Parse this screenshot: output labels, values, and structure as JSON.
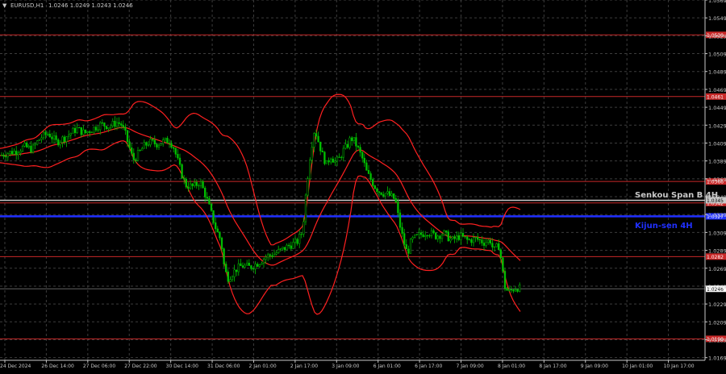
{
  "window": {
    "symbol_title": "EURUSD,H1",
    "ohlc": "1.0246 1.0249 1.0243 1.0246"
  },
  "colors": {
    "background": "#000000",
    "grid": "#3c3c3c",
    "candle_up": "#00c000",
    "candle_down": "#00c000",
    "ichimoku_tenkan": "#ff2020",
    "ichimoku_kijun": "#ff2020",
    "bollinger": "#ff2020",
    "level_line": "#c82828",
    "senkou_line": "#c8c8c8",
    "kijun_4h_line": "#2030ff",
    "axis_text": "#c8c8c8",
    "current_price_label_bg": "#ffffff"
  },
  "annotations": {
    "senkou_label": "Senkou Span B 4H",
    "kijun_label": "Kijun-sen 4H"
  },
  "chart_data": {
    "type": "candlestick",
    "ylim": [
      1.0166,
      1.0569
    ],
    "y_ticks": [
      "1.0569",
      "1.0549",
      "1.0529",
      "1.0509",
      "1.0489",
      "1.0469",
      "1.0449",
      "1.0429",
      "1.0409",
      "1.0389",
      "1.0369",
      "1.0349",
      "1.0329",
      "1.0309",
      "1.0289",
      "1.0269",
      "1.0249",
      "1.0229",
      "1.0209",
      "1.0189",
      "1.0169"
    ],
    "y_tick_values": [
      1.0569,
      1.0549,
      1.0529,
      1.0509,
      1.0489,
      1.0469,
      1.0449,
      1.0429,
      1.0409,
      1.0389,
      1.0369,
      1.0349,
      1.0329,
      1.0309,
      1.0289,
      1.0269,
      1.0249,
      1.0229,
      1.0209,
      1.0189,
      1.0169
    ],
    "x_tick_labels": [
      "24 Dec 2024",
      "26 Dec 14:00",
      "27 Dec 06:00",
      "27 Dec 22:00",
      "30 Dec 14:00",
      "31 Dec 06:00",
      "2 Jan 01:00",
      "2 Jan 17:00",
      "3 Jan 09:00",
      "6 Jan 01:00",
      "6 Jan 17:00",
      "7 Jan 09:00",
      "8 Jan 01:00",
      "8 Jan 17:00",
      "9 Jan 09:00",
      "10 Jan 01:00",
      "10 Jan 17:00"
    ],
    "horizontal_levels": [
      {
        "value": 1.053,
        "label": "1.0530",
        "kind": "level"
      },
      {
        "value": 1.0461,
        "label": "1.0461",
        "kind": "level"
      },
      {
        "value": 1.0366,
        "label": "1.0366",
        "kind": "level"
      },
      {
        "value": 1.0342,
        "label": "1.0342",
        "kind": "level"
      },
      {
        "value": 1.0282,
        "label": "1.0282",
        "kind": "level"
      },
      {
        "value": 1.019,
        "label": "1.0190",
        "kind": "level"
      },
      {
        "value": 1.0345,
        "label": "1.0345",
        "kind": "senkou"
      },
      {
        "value": 1.0327,
        "label": "1.0327",
        "kind": "kijun"
      }
    ],
    "current_price": {
      "value": 1.0246,
      "label": "1.0246"
    },
    "close_path": [
      [
        0,
        1.0395
      ],
      [
        10,
        1.0398
      ],
      [
        20,
        1.04
      ],
      [
        30,
        1.0405
      ],
      [
        40,
        1.0402
      ],
      [
        50,
        1.0415
      ],
      [
        60,
        1.042
      ],
      [
        70,
        1.041
      ],
      [
        80,
        1.0415
      ],
      [
        95,
        1.0425
      ],
      [
        105,
        1.042
      ],
      [
        115,
        1.0425
      ],
      [
        125,
        1.043
      ],
      [
        135,
        1.0428
      ],
      [
        145,
        1.0432
      ],
      [
        150,
        1.043
      ],
      [
        155,
        1.042
      ],
      [
        160,
        1.0405
      ],
      [
        165,
        1.039
      ],
      [
        170,
        1.0395
      ],
      [
        178,
        1.0405
      ],
      [
        185,
        1.041
      ],
      [
        195,
        1.0408
      ],
      [
        200,
        1.041
      ],
      [
        210,
        1.0412
      ],
      [
        215,
        1.0405
      ],
      [
        220,
        1.039
      ],
      [
        225,
        1.0375
      ],
      [
        230,
        1.0362
      ],
      [
        240,
        1.036
      ],
      [
        248,
        1.0366
      ],
      [
        255,
        1.035
      ],
      [
        262,
        1.033
      ],
      [
        268,
        1.0312
      ],
      [
        274,
        1.03
      ],
      [
        278,
        1.027
      ],
      [
        282,
        1.0258
      ],
      [
        287,
        1.0262
      ],
      [
        293,
        1.0268
      ],
      [
        300,
        1.0272
      ],
      [
        310,
        1.027
      ],
      [
        320,
        1.0275
      ],
      [
        330,
        1.0282
      ],
      [
        340,
        1.0285
      ],
      [
        350,
        1.029
      ],
      [
        360,
        1.0295
      ],
      [
        368,
        1.0298
      ],
      [
        375,
        1.031
      ],
      [
        380,
        1.036
      ],
      [
        385,
        1.04
      ],
      [
        390,
        1.0425
      ],
      [
        395,
        1.041
      ],
      [
        400,
        1.0395
      ],
      [
        405,
        1.0385
      ],
      [
        410,
        1.0395
      ],
      [
        415,
        1.0388
      ],
      [
        420,
        1.039
      ],
      [
        425,
        1.04
      ],
      [
        430,
        1.0405
      ],
      [
        435,
        1.0415
      ],
      [
        440,
        1.041
      ],
      [
        445,
        1.04
      ],
      [
        450,
        1.039
      ],
      [
        455,
        1.0375
      ],
      [
        460,
        1.0368
      ],
      [
        465,
        1.036
      ],
      [
        470,
        1.0355
      ],
      [
        480,
        1.0352
      ],
      [
        490,
        1.0346
      ],
      [
        495,
        1.032
      ],
      [
        500,
        1.03
      ],
      [
        505,
        1.0285
      ],
      [
        510,
        1.03
      ],
      [
        520,
        1.0306
      ],
      [
        530,
        1.031
      ],
      [
        540,
        1.0305
      ],
      [
        550,
        1.0308
      ],
      [
        560,
        1.03
      ],
      [
        570,
        1.0305
      ],
      [
        580,
        1.03
      ],
      [
        590,
        1.0302
      ],
      [
        600,
        1.0298
      ],
      [
        608,
        1.03
      ],
      [
        612,
        1.0288
      ],
      [
        618,
        1.0295
      ],
      [
        622,
        1.0275
      ],
      [
        625,
        1.025
      ],
      [
        630,
        1.0242
      ],
      [
        635,
        1.0245
      ],
      [
        640,
        1.0248
      ],
      [
        645,
        1.0246
      ]
    ]
  }
}
